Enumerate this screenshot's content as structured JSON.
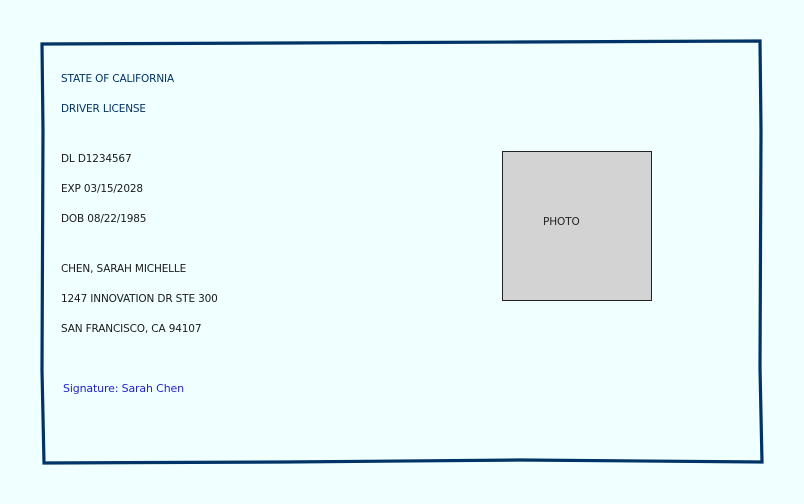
{
  "card": {
    "state": "STATE OF CALIFORNIA",
    "document_type": "DRIVER LICENSE",
    "dl_number": "DL D1234567",
    "expiration": "EXP 03/15/2028",
    "dob": "DOB 08/22/1985",
    "name": "CHEN, SARAH MICHELLE",
    "address_line1": "1247 INNOVATION DR STE 300",
    "address_line2": "SAN FRANCISCO, CA 94107",
    "photo_label": "PHOTO",
    "signature": "Signature: Sarah Chen"
  },
  "colors": {
    "background": "#f0ffff",
    "border": "#003366",
    "header_text": "#003366",
    "signature_text": "#1f1fd6",
    "photo_fill": "#d3d3d3"
  }
}
